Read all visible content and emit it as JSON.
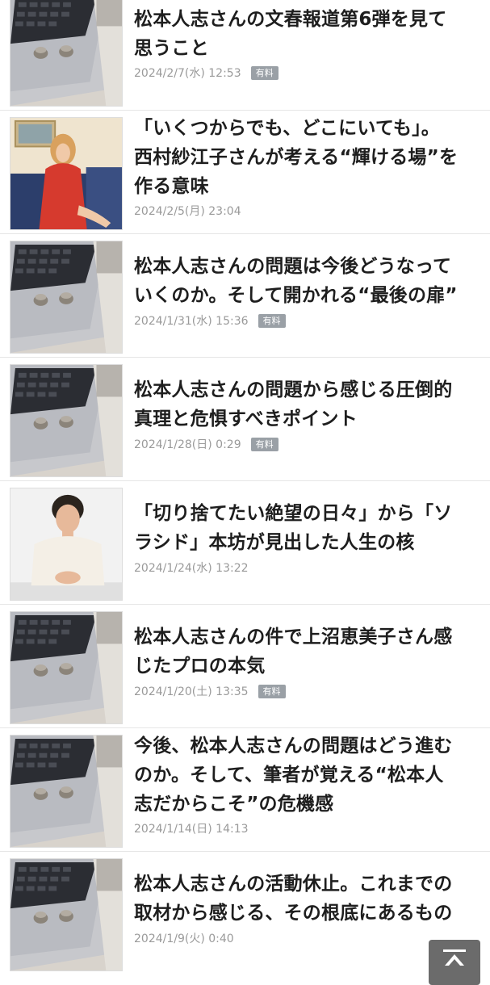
{
  "articles": [
    {
      "title": "松本人志さんの文春報道第6弾を見て\n思うこと",
      "date": "2024/2/7(水) 12:53",
      "badge": "有料",
      "thumb": "laptop-earbuds-image"
    },
    {
      "title": "「いくつからでも、どこにいても」。\n西村紗江子さんが考える“輝ける場”を\n作る意味",
      "date": "2024/2/5(月) 23:04",
      "badge": "",
      "thumb": "woman-red-dress-photo"
    },
    {
      "title": "松本人志さんの問題は今後どうなって\nいくのか。そして開かれる“最後の扉”",
      "date": "2024/1/31(水) 15:36",
      "badge": "有料",
      "thumb": "laptop-earbuds-image"
    },
    {
      "title": "松本人志さんの問題から感じる圧倒的\n真理と危惧すべきポイント",
      "date": "2024/1/28(日) 0:29",
      "badge": "有料",
      "thumb": "laptop-earbuds-image"
    },
    {
      "title": "「切り捨てたい絶望の日々」から「ソ\nラシド」本坊が見出した人生の核",
      "date": "2024/1/24(水) 13:22",
      "badge": "",
      "thumb": "man-white-sweater-photo"
    },
    {
      "title": "松本人志さんの件で上沼恵美子さん感\nじたプロの本気",
      "date": "2024/1/20(土) 13:35",
      "badge": "有料",
      "thumb": "laptop-earbuds-image"
    },
    {
      "title": "今後、松本人志さんの問題はどう進む\nのか。そして、筆者が覚える“松本人\n志だからこそ”の危機感",
      "date": "2024/1/14(日) 14:13",
      "badge": "",
      "thumb": "laptop-earbuds-image"
    },
    {
      "title": "松本人志さんの活動休止。これまでの\n取材から感じる、その根底にあるもの",
      "date": "2024/1/9(火) 0:40",
      "badge": "",
      "thumb": "laptop-earbuds-image"
    }
  ],
  "scroll_top": {
    "icon": "arrow-up-to-top-icon"
  }
}
